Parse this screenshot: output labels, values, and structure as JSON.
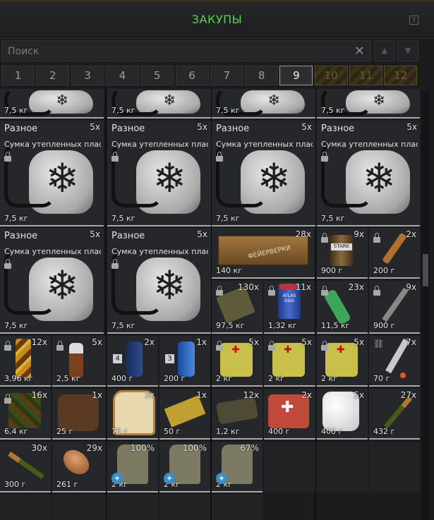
{
  "window": {
    "title": "ЗАКУПЫ",
    "help_label": "?"
  },
  "search": {
    "placeholder": "Поиск"
  },
  "pages": [
    {
      "label": "1",
      "state": "normal"
    },
    {
      "label": "2",
      "state": "normal"
    },
    {
      "label": "3",
      "state": "normal"
    },
    {
      "label": "4",
      "state": "normal"
    },
    {
      "label": "5",
      "state": "normal"
    },
    {
      "label": "6",
      "state": "normal"
    },
    {
      "label": "7",
      "state": "normal"
    },
    {
      "label": "8",
      "state": "normal"
    },
    {
      "label": "9",
      "state": "active"
    },
    {
      "label": "10",
      "state": "locked"
    },
    {
      "label": "11",
      "state": "locked"
    },
    {
      "label": "12",
      "state": "locked"
    }
  ],
  "items": [
    {
      "name": "",
      "category": "",
      "count": "",
      "weight": "7,5 кг",
      "art": "bag",
      "locked": false
    },
    {
      "name": "",
      "category": "",
      "count": "",
      "weight": "7,5 кг",
      "art": "bag",
      "locked": false
    },
    {
      "name": "",
      "category": "",
      "count": "",
      "weight": "7,5 кг",
      "art": "bag",
      "locked": false
    },
    {
      "name": "",
      "category": "",
      "count": "",
      "weight": "7,5 кг",
      "art": "bag",
      "locked": false
    },
    {
      "category": "Разное",
      "name": "Сумка утепленных плас...",
      "count": "5x",
      "weight": "7,5 кг",
      "art": "bag",
      "locked": true
    },
    {
      "category": "Разное",
      "name": "Сумка утепленных плас...",
      "count": "5x",
      "weight": "7,5 кг",
      "art": "bag",
      "locked": true
    },
    {
      "category": "Разное",
      "name": "Сумка утепленных плас...",
      "count": "5x",
      "weight": "7,5 кг",
      "art": "bag",
      "locked": true
    },
    {
      "category": "Разное",
      "name": "Сумка утепленных плас...",
      "count": "5x",
      "weight": "7,5 кг",
      "art": "bag",
      "locked": true
    },
    {
      "category": "Разное",
      "name": "Сумка утепленных плас...",
      "count": "5x",
      "weight": "7,5 кг",
      "art": "bag",
      "locked": true
    },
    {
      "category": "Разное",
      "name": "Сумка утепленных плас...",
      "count": "5x",
      "weight": "7,5 кг",
      "art": "bag",
      "locked": true
    },
    {
      "count": "28x",
      "weight": "140 кг",
      "art": "crate",
      "crate_label": "ФЕЙЕРВЕРКИ"
    },
    {
      "count": "9x",
      "weight": "900 г",
      "art": "can",
      "locked": true,
      "label": "STARK"
    },
    {
      "count": "2x",
      "weight": "200 г",
      "art": "flare",
      "locked": true
    },
    {
      "count": "130x",
      "weight": "97,5 кг",
      "art": "pack",
      "locked": true
    },
    {
      "count": "11x",
      "weight": "1,32 кг",
      "art": "jar",
      "locked": true,
      "label": "ATLAS D&G"
    },
    {
      "count": "23x",
      "weight": "11,5 кг",
      "art": "bottle",
      "locked": true
    },
    {
      "count": "9x",
      "weight": "900 г",
      "art": "syringe",
      "locked": true
    },
    {
      "count": "12x",
      "weight": "3,96 кг",
      "art": "camo",
      "locked": true
    },
    {
      "count": "5x",
      "weight": "2,5 кг",
      "art": "wine",
      "locked": true
    },
    {
      "count": "2x",
      "weight": "400 г",
      "art": "spray",
      "badge": "4"
    },
    {
      "count": "1x",
      "weight": "200 г",
      "art": "spray2",
      "badge": "3"
    },
    {
      "count": "5x",
      "weight": "2 кг",
      "art": "medkit",
      "locked": true
    },
    {
      "count": "5x",
      "weight": "2 кг",
      "art": "medkit",
      "locked": true
    },
    {
      "count": "5x",
      "weight": "2 кг",
      "art": "medkit",
      "locked": true
    },
    {
      "count": "7x",
      "weight": "70 г",
      "art": "stick",
      "chained": true
    },
    {
      "count": "16x",
      "weight": "6,4 кг",
      "art": "camo2",
      "locked": true
    },
    {
      "count": "1x",
      "weight": "25 г",
      "art": "bread"
    },
    {
      "count": "3x",
      "weight": "75 г",
      "art": "toast"
    },
    {
      "count": "1x",
      "weight": "50 г",
      "art": "box"
    },
    {
      "count": "12x",
      "weight": "1,2 кг",
      "art": "bar"
    },
    {
      "count": "2x",
      "weight": "400 г",
      "art": "firstaid"
    },
    {
      "count": "5x",
      "weight": "400 г",
      "art": "roll"
    },
    {
      "count": "27x",
      "weight": "432 г",
      "art": "bullet"
    },
    {
      "count": "30x",
      "weight": "300 г",
      "art": "bullet2"
    },
    {
      "count": "29x",
      "weight": "261 г",
      "art": "slug"
    },
    {
      "count": "100%",
      "weight": "2 кг",
      "art": "plate",
      "star": true
    },
    {
      "count": "100%",
      "weight": "2 кг",
      "art": "plate",
      "star": true
    },
    {
      "count": "67%",
      "weight": "2 кг",
      "art": "plate",
      "star": true
    },
    {
      "count": "",
      "weight": "",
      "art": "empty"
    },
    {
      "count": "",
      "weight": "",
      "art": "empty"
    },
    {
      "count": "",
      "weight": "",
      "art": "empty"
    },
    {
      "count": "",
      "weight": "",
      "art": "empty"
    },
    {
      "count": "",
      "weight": "",
      "art": "empty"
    },
    {
      "count": "",
      "weight": "",
      "art": "empty"
    },
    {
      "count": "",
      "weight": "",
      "art": "empty"
    },
    {
      "count": "",
      "weight": "",
      "art": "empty"
    }
  ]
}
